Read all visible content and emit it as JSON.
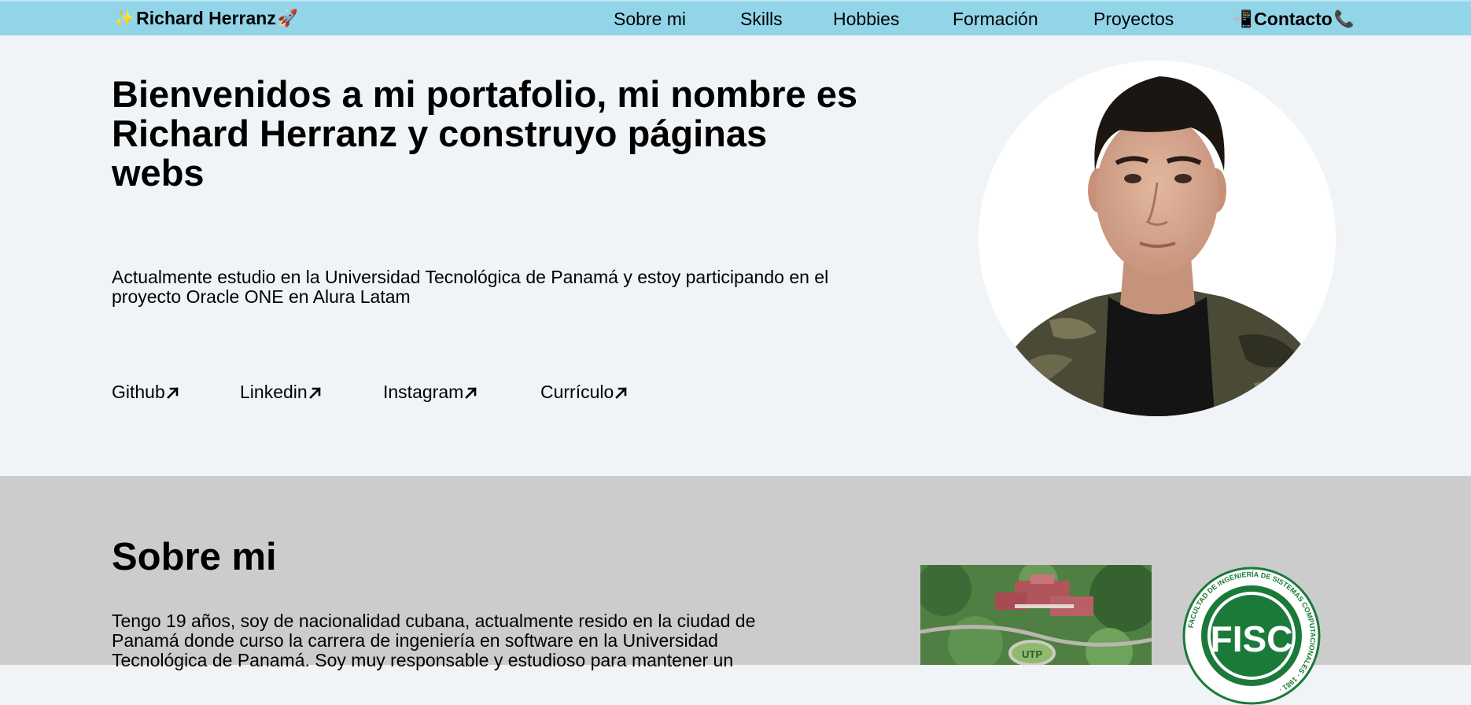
{
  "nav": {
    "brand_prefix_emoji": "✨",
    "brand": "Richard Herranz",
    "brand_suffix_emoji": "🚀",
    "items": [
      {
        "label": "Sobre mi"
      },
      {
        "label": "Skills"
      },
      {
        "label": "Hobbies"
      },
      {
        "label": "Formación"
      },
      {
        "label": "Proyectos"
      }
    ],
    "contact_prefix_emoji": "📲",
    "contact": "Contacto",
    "contact_suffix_emoji": "📞"
  },
  "hero": {
    "title": "Bienvenidos a mi portafolio, mi nombre es Richard Herranz y construyo páginas webs",
    "description": "Actualmente estudio en la Universidad Tecnológica de Panamá y estoy participando en el proyecto Oracle ONE en Alura Latam",
    "links": [
      {
        "label": "Github",
        "icon": "arrow-up-right-icon"
      },
      {
        "label": "Linkedin",
        "icon": "arrow-up-right-icon"
      },
      {
        "label": "Instagram",
        "icon": "arrow-up-right-icon"
      },
      {
        "label": "Currículo",
        "icon": "arrow-up-right-icon"
      }
    ]
  },
  "about": {
    "title": "Sobre mi",
    "text": "Tengo 19 años, soy de nacionalidad cubana, actualmente resido en la ciudad de Panamá donde curso la carrera de ingeniería en software en la Universidad Tecnológica de Panamá. Soy muy responsable y estudioso para mantener un",
    "campus_badge": "UTP",
    "logo_ring_text": "FACULTAD DE INGENIERÍA DE SISTEMAS COMPUTACIONALES · 1981 ·",
    "logo_initials": "FISC"
  },
  "colors": {
    "navbar": "#92d5e9",
    "hero_bg": "#f0f4f6",
    "about_bg": "#cccccc",
    "fisc_green": "#1b7a3a"
  }
}
